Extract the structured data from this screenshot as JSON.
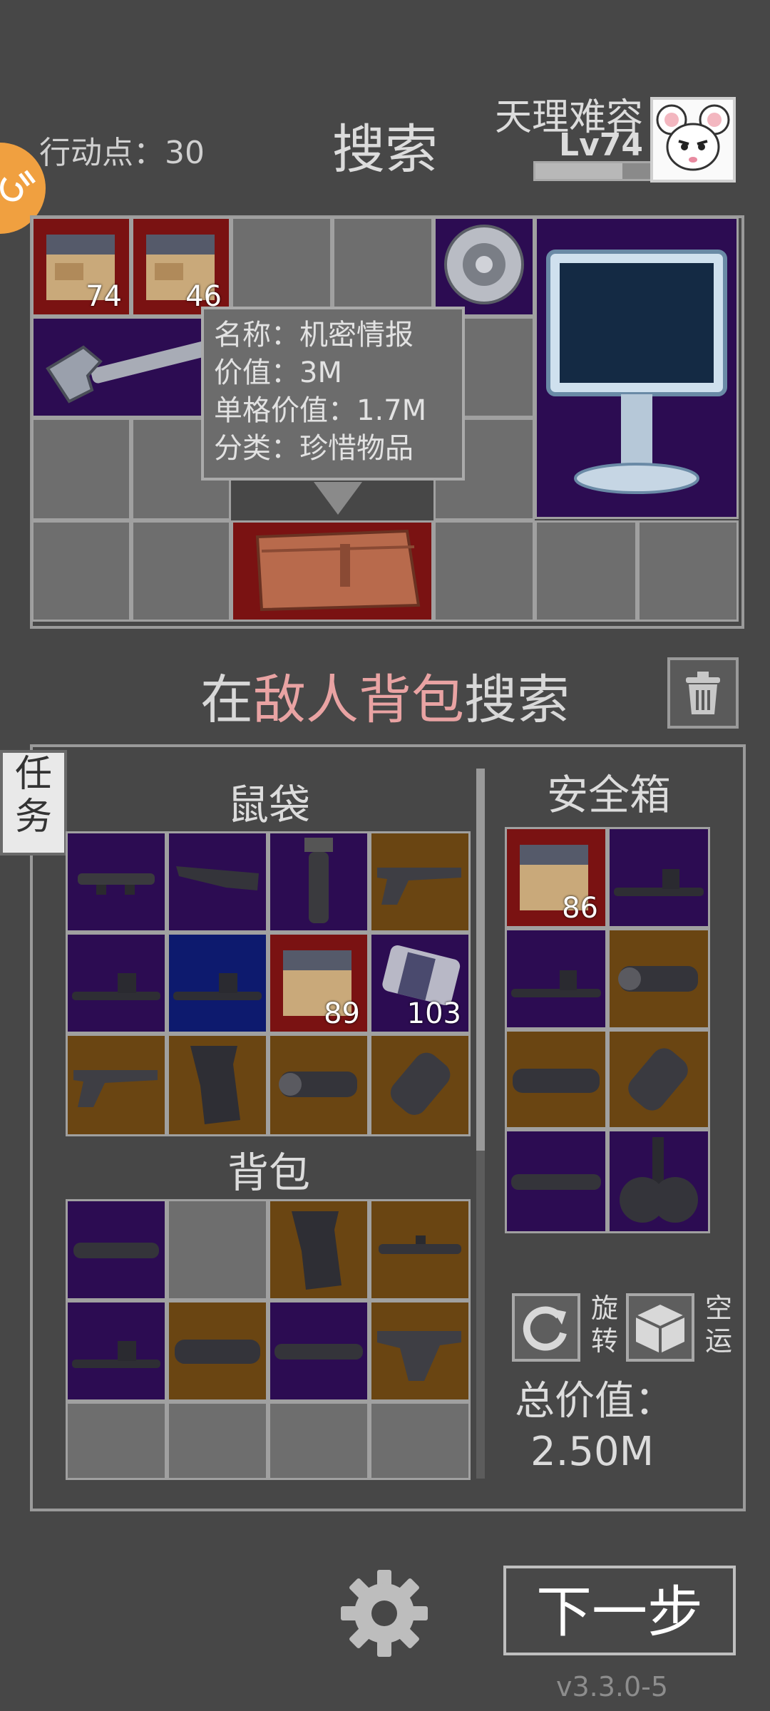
{
  "header": {
    "action_points_label": "行动点：30",
    "title": "搜索",
    "player_name": "天理难容",
    "player_level": "Lv74",
    "xp_fraction": 0.75
  },
  "loot_grid": {
    "counts": [
      "74",
      "46"
    ]
  },
  "tooltip": {
    "name_line": "名称：机密情报",
    "value_line": "价值：3M",
    "unit_value_line": "单格价值：1.7M",
    "category_line": "分类：珍惜物品"
  },
  "search_title": {
    "prefix": "在",
    "highlight": "敌人背包",
    "suffix": "搜索",
    "highlight_color": "#e9a3a3"
  },
  "task_tab": {
    "line1": "任",
    "line2": "务"
  },
  "pouch": {
    "label": "鼠袋",
    "counts": [
      "89",
      "103"
    ]
  },
  "backpack": {
    "label": "背包"
  },
  "safe_box": {
    "label": "安全箱",
    "counts": [
      "86"
    ]
  },
  "controls": {
    "rotate_label_1": "旋",
    "rotate_label_2": "转",
    "airdrop_label_1": "空",
    "airdrop_label_2": "运",
    "total_label": "总价值：",
    "total_value": "2.50M",
    "next_button": "下一步",
    "version": "v3.3.0-5"
  },
  "colors": {
    "rarity_red": "#7a1212",
    "rarity_purple": "#2c0c52",
    "rarity_blue": "#0d1a6e",
    "rarity_gold": "#6a4512",
    "empty": "#6e6e6e"
  }
}
